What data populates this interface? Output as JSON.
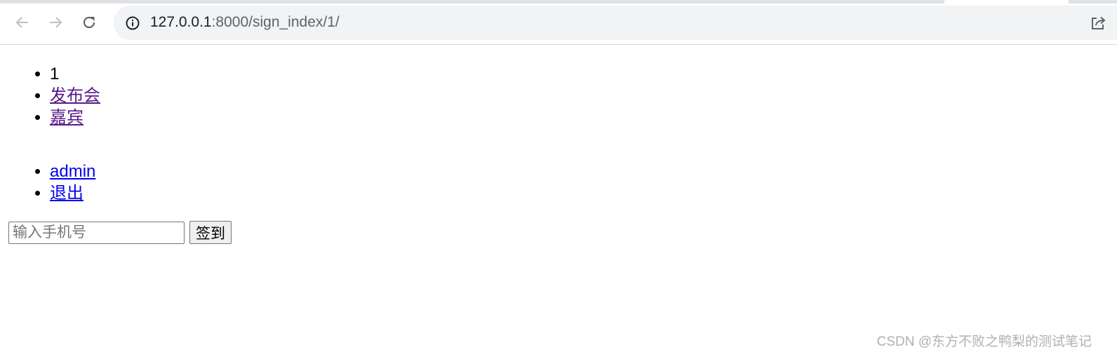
{
  "browser": {
    "url_host": "127.0.0.1",
    "url_path": ":8000/sign_index/1/"
  },
  "nav_list": [
    {
      "label": "1",
      "link": false
    },
    {
      "label": "发布会",
      "link": true
    },
    {
      "label": "嘉宾",
      "link": true
    }
  ],
  "user_list": [
    {
      "label": "admin"
    },
    {
      "label": "退出"
    }
  ],
  "sign_form": {
    "phone_placeholder": "输入手机号",
    "phone_value": "",
    "submit_label": "签到"
  },
  "watermark": "CSDN @东方不败之鸭梨的测试笔记",
  "colors": {
    "link_visited": "#551a8b",
    "link_unvisited": "#0000ee",
    "omnibox_bg": "#f1f3f4"
  },
  "icons": [
    "back-arrow-icon",
    "forward-arrow-icon",
    "reload-icon",
    "info-icon",
    "share-icon"
  ]
}
